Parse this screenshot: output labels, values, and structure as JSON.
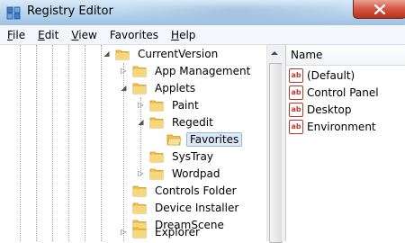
{
  "window": {
    "title": "Registry Editor"
  },
  "menu": [
    {
      "label": "File",
      "accel": "F",
      "rest": "ile"
    },
    {
      "label": "Edit",
      "accel": "E",
      "rest": "dit"
    },
    {
      "label": "View",
      "accel": "V",
      "rest": "iew"
    },
    {
      "label": "Favorites",
      "accel": "",
      "rest": "Favorites"
    },
    {
      "label": "Help",
      "accel": "H",
      "rest": "elp"
    }
  ],
  "tree": {
    "items": [
      {
        "label": "CurrentVersion",
        "expander": "expanded"
      },
      {
        "label": "App Management",
        "expander": "collapsed"
      },
      {
        "label": "Applets",
        "expander": "expanded"
      },
      {
        "label": "Paint",
        "expander": "collapsed"
      },
      {
        "label": "Regedit",
        "expander": "expanded"
      },
      {
        "label": "Favorites",
        "expander": "none",
        "selected": true
      },
      {
        "label": "SysTray",
        "expander": "none"
      },
      {
        "label": "Wordpad",
        "expander": "collapsed"
      },
      {
        "label": "Controls Folder",
        "expander": "none"
      },
      {
        "label": "Device Installer",
        "expander": "none"
      },
      {
        "label": "DreamScene",
        "expander": "none"
      },
      {
        "label": "Explorer",
        "expander": "collapsed"
      }
    ]
  },
  "list": {
    "column_name": "Name",
    "values": [
      {
        "name": "(Default)",
        "icon": "ab-string-icon"
      },
      {
        "name": "Control Panel",
        "icon": "ab-string-icon"
      },
      {
        "name": "Desktop",
        "icon": "ab-string-icon"
      },
      {
        "name": "Environment",
        "icon": "ab-string-icon"
      }
    ]
  },
  "colors": {
    "selection": "#dde8f6",
    "folder": "#f2c04c",
    "string_icon": "#c0392b"
  }
}
